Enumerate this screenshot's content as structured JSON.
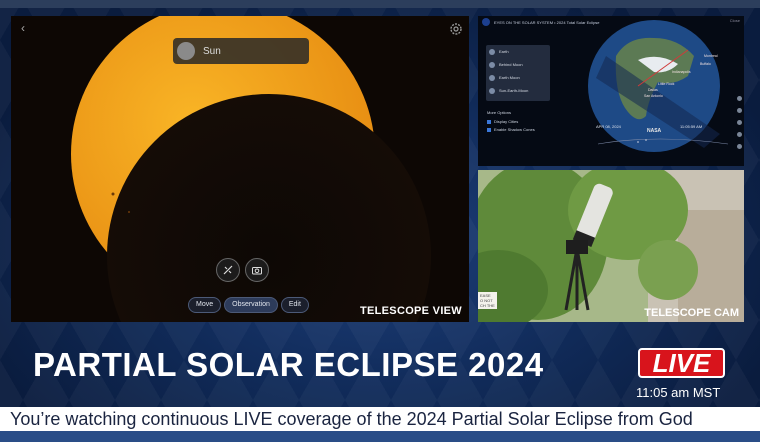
{
  "telescope_view": {
    "target_label": "Sun",
    "buttons": {
      "move": "Move",
      "observation": "Observation",
      "edit": "Edit"
    },
    "caption": "TELESCOPE VIEW"
  },
  "eyes_panel": {
    "title": "EYES ON THE SOLAR SYSTEM  •  2024 Total Solar Eclipse",
    "close_label": "Close",
    "menu_items": [
      "Earth",
      "Behind Moon",
      "Earth Moon",
      "Sun-Earth-Moon"
    ],
    "more_options_label": "More Options",
    "options": [
      "Display Cities",
      "Enable Shadow Cones"
    ],
    "date": "APR 08, 2024",
    "time": "11:05:59 AM",
    "logo_text": "NASA",
    "cities": [
      "Montreal",
      "Buffalo",
      "Indianapolis",
      "Little Rock",
      "Dallas",
      "San Antonio"
    ]
  },
  "telescope_cam": {
    "caption": "TELESCOPE CAM",
    "sign_text": "EASE\nO NOT\nCH THE"
  },
  "headline": "PARTIAL SOLAR ECLIPSE 2024",
  "live_badge": "LIVE",
  "timestamp": "11:05 am MST",
  "ticker": "You’re watching continuous LIVE coverage of the 2024 Partial Solar Eclipse from God",
  "colors": {
    "live_red": "#d8141c",
    "sun_orange": "#f2a51e",
    "background_blue": "#12305f"
  }
}
